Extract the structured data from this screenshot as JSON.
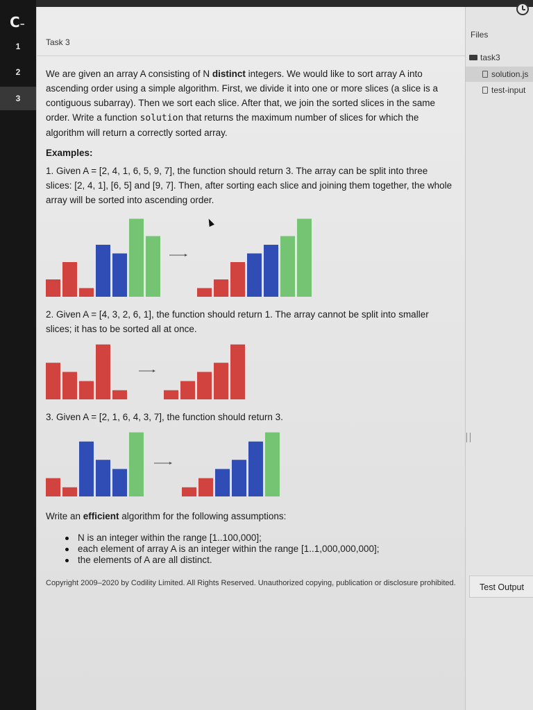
{
  "sidebar": {
    "logo": "C",
    "logo_dash": "–",
    "tasks": [
      {
        "label": "1"
      },
      {
        "label": "2"
      },
      {
        "label": "3"
      }
    ]
  },
  "header": {
    "task_title": "Task 3"
  },
  "problem": {
    "para1_a": "We are given an array A consisting of N ",
    "para1_bold": "distinct",
    "para1_b": " integers. We would like to sort array A into ascending order using a simple algorithm. First, we divide it into one or more slices (a slice is a contiguous subarray). Then we sort each slice. After that, we join the sorted slices in the same order. Write a function ",
    "para1_code": "solution",
    "para1_c": " that returns the maximum number of slices for which the algorithm will return a correctly sorted array.",
    "examples_heading": "Examples:",
    "example1": "1. Given A = [2, 4, 1, 6, 5, 9, 7], the function should return 3. The array can be split into three slices: [2, 4, 1], [6, 5] and [9, 7]. Then, after sorting each slice and joining them together, the whole array will be sorted into ascending order.",
    "example2": "2. Given A = [4, 3, 2, 6, 1], the function should return 1. The array cannot be split into smaller slices; it has to be sorted all at once.",
    "example3": "3. Given A = [2, 1, 6, 4, 3, 7], the function should return 3.",
    "assumptions_a": "Write an ",
    "assumptions_bold": "efficient",
    "assumptions_b": " algorithm for the following assumptions:",
    "bullets": [
      "N is an integer within the range [1..100,000];",
      "each element of array A is an integer within the range [1..1,000,000,000];",
      "the elements of A are all distinct."
    ],
    "copyright": "Copyright 2009–2020 by Codility Limited. All Rights Reserved. Unauthorized copying, publication or disclosure prohibited."
  },
  "files": {
    "header": "Files",
    "folder": "task3",
    "items": [
      "solution.js",
      "test-input"
    ]
  },
  "test_output_label": "Test Output",
  "colors": {
    "red": "#d0433e",
    "blue": "#2f4db5",
    "green": "#74c474"
  },
  "chart_data": [
    {
      "type": "bar",
      "title": "",
      "before": {
        "values": [
          2,
          4,
          1,
          6,
          5,
          9,
          7
        ],
        "colors": [
          "red",
          "red",
          "red",
          "blue",
          "blue",
          "green",
          "green"
        ]
      },
      "after": {
        "values": [
          1,
          2,
          4,
          5,
          6,
          7,
          9
        ],
        "colors": [
          "red",
          "red",
          "red",
          "blue",
          "blue",
          "green",
          "green"
        ]
      }
    },
    {
      "type": "bar",
      "title": "",
      "before": {
        "values": [
          4,
          3,
          2,
          6,
          1
        ],
        "colors": [
          "red",
          "red",
          "red",
          "red",
          "red"
        ]
      },
      "after": {
        "values": [
          1,
          2,
          3,
          4,
          6
        ],
        "colors": [
          "red",
          "red",
          "red",
          "red",
          "red"
        ]
      }
    },
    {
      "type": "bar",
      "title": "",
      "before": {
        "values": [
          2,
          1,
          6,
          4,
          3,
          7
        ],
        "colors": [
          "red",
          "red",
          "blue",
          "blue",
          "blue",
          "green"
        ]
      },
      "after": {
        "values": [
          1,
          2,
          3,
          4,
          6,
          7
        ],
        "colors": [
          "red",
          "red",
          "blue",
          "blue",
          "blue",
          "green"
        ]
      }
    }
  ]
}
